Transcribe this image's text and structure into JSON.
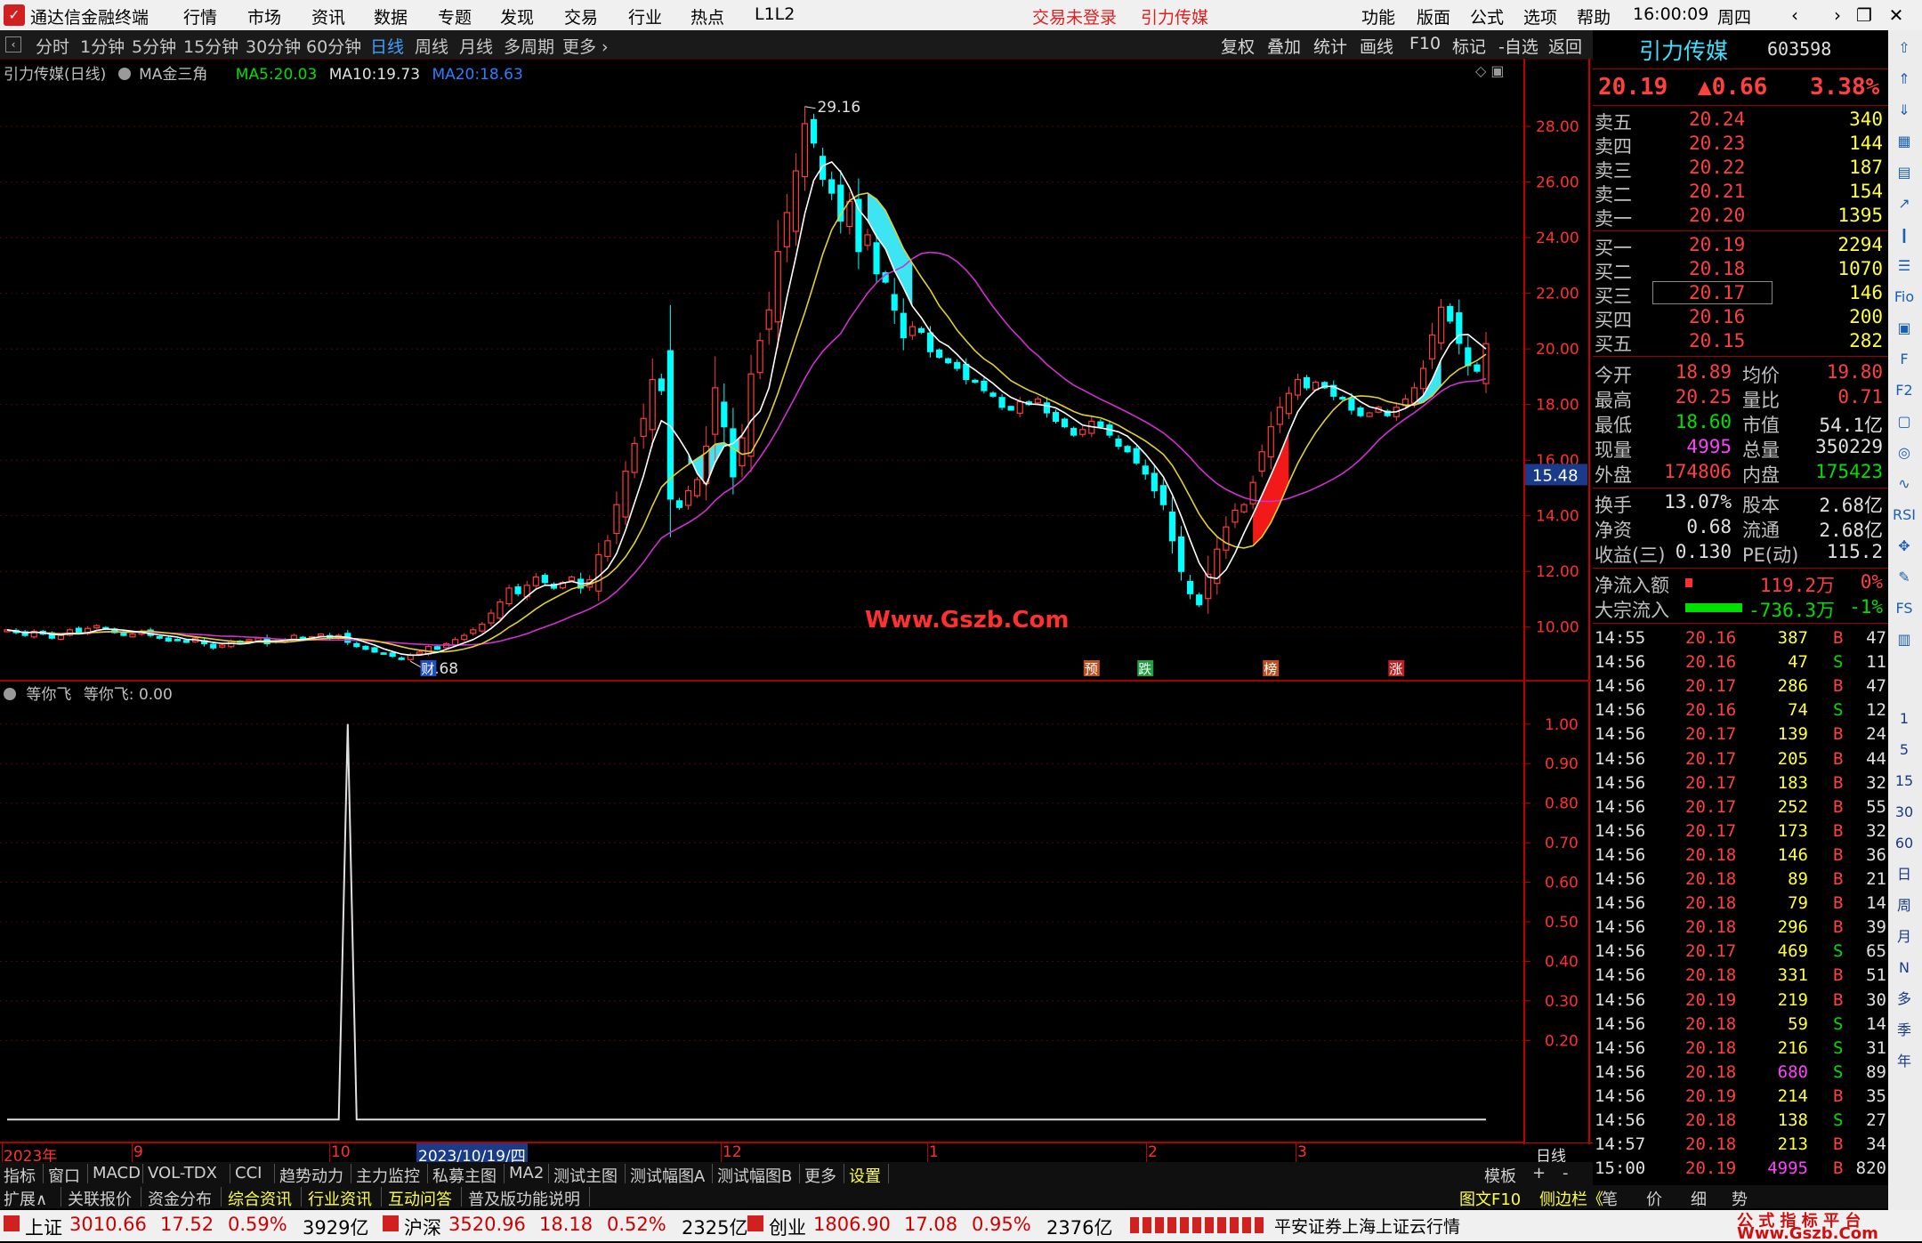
{
  "app": {
    "name": "通达信金融终端",
    "menus": [
      "行情",
      "市场",
      "资讯",
      "数据",
      "专题",
      "发现",
      "交易",
      "行业",
      "热点",
      "L1L2"
    ],
    "login_status": "交易未登录",
    "stock_title": "引力传媒",
    "right_menus": [
      "功能",
      "版面",
      "公式",
      "选项",
      "帮助"
    ],
    "clock": "16:00:09",
    "weekday": "周四",
    "win_buttons": [
      "back-icon",
      "forward-icon",
      "restore-icon",
      "close-icon"
    ],
    "win_glyphs": [
      "‹",
      "›",
      "❐",
      "✕"
    ]
  },
  "periods": {
    "items": [
      "分时",
      "1分钟",
      "5分钟",
      "15分钟",
      "30分钟",
      "60分钟",
      "日线",
      "周线",
      "月线",
      "多周期",
      "更多 ›"
    ],
    "active_index": 6
  },
  "toolbar": [
    "复权",
    "叠加",
    "统计",
    "画线",
    "F10",
    "标记",
    "-自选",
    "返回"
  ],
  "chart_header": {
    "name": "引力传媒(日线)",
    "indicator": "MA金三角",
    "ma5_label": "MA5:",
    "ma5": "20.03",
    "ma10_label": "MA10:",
    "ma10": "19.73",
    "ma20_label": "MA20:",
    "ma20": "18.63"
  },
  "sub_header": {
    "indicator": "等你飞",
    "value_label": "等你飞: 0.00"
  },
  "watermark": "Www.Gszb.Com",
  "event_markers": [
    "财",
    "预",
    "跌",
    "榜",
    "涨"
  ],
  "current_price_label": "15.48",
  "chart_data": [
    {
      "type": "candlestick",
      "title": "引力传媒(日线)",
      "y_ticks": [
        10.0,
        12.0,
        14.0,
        16.0,
        18.0,
        20.0,
        22.0,
        24.0,
        26.0,
        28.0
      ],
      "ylim": [
        8.2,
        29.6
      ],
      "high_label": "29.16",
      "low_label": "8.68",
      "series": [
        {
          "name": "MA5",
          "color": "#ffffff"
        },
        {
          "name": "MA10",
          "color": "#e0d030"
        },
        {
          "name": "MA20",
          "color": "#d030d0"
        }
      ],
      "close": [
        9.9,
        9.8,
        9.7,
        9.85,
        9.75,
        9.6,
        9.7,
        9.9,
        9.8,
        9.95,
        10.05,
        9.95,
        9.8,
        9.7,
        9.75,
        9.85,
        9.7,
        9.6,
        9.5,
        9.55,
        9.45,
        9.6,
        9.4,
        9.25,
        9.35,
        9.5,
        9.45,
        9.55,
        9.6,
        9.4,
        9.5,
        9.55,
        9.7,
        9.6,
        9.65,
        9.75,
        9.6,
        9.7,
        9.45,
        9.3,
        9.2,
        9.1,
        9.05,
        8.95,
        8.85,
        9.0,
        9.1,
        9.3,
        9.2,
        9.4,
        9.55,
        9.7,
        9.9,
        10.1,
        10.5,
        10.9,
        11.4,
        11.2,
        11.5,
        11.8,
        11.6,
        11.4,
        11.6,
        11.8,
        11.4,
        11.7,
        12.6,
        13.1,
        14.4,
        15.6,
        16.6,
        17.5,
        18.9,
        18.5,
        14.6,
        14.3,
        14.9,
        15.3,
        16.5,
        18.6,
        17.2,
        15.4,
        16.8,
        19.1,
        20.3,
        21.4,
        23.5,
        24.9,
        26.4,
        28.1,
        27.4,
        26.1,
        25.6,
        24.6,
        25.3,
        23.5,
        24.1,
        22.7,
        22.4,
        21.4,
        20.4,
        20.8,
        20.6,
        19.9,
        19.7,
        19.5,
        19.3,
        18.9,
        18.8,
        18.5,
        18.3,
        17.9,
        17.8,
        18.1,
        18.0,
        18.2,
        17.7,
        17.4,
        17.2,
        16.9,
        17.1,
        17.4,
        17.2,
        16.9,
        16.5,
        16.3,
        15.9,
        15.5,
        14.9,
        14.4,
        13.1,
        12.0,
        11.2,
        10.8,
        11.9,
        12.8,
        13.6,
        14.2,
        14.4,
        15.2,
        16.3,
        17.2,
        17.9,
        18.4,
        18.9,
        18.6,
        18.8,
        18.6,
        18.3,
        18.2,
        17.8,
        17.6,
        17.7,
        17.9,
        17.6,
        17.9,
        18.2,
        18.6,
        19.3,
        20.5,
        21.5,
        21.0,
        20.2,
        19.4,
        19.2,
        20.19
      ],
      "sub_type": "line",
      "sub_y_ticks": [
        0.2,
        0.3,
        0.4,
        0.5,
        0.6,
        0.7,
        0.8,
        0.9,
        1.0
      ],
      "sub_ylim": [
        -0.04,
        1.04
      ],
      "sub_signal_bar": 38,
      "time_labels": [
        "2023年",
        "9",
        "10",
        "2023/10/19/四",
        "12",
        "1",
        "2",
        "3"
      ]
    }
  ],
  "quote": {
    "name": "引力传媒",
    "code": "603598",
    "price": "20.19",
    "change": "▲0.66",
    "pct": "3.38%",
    "asks": [
      {
        "label": "卖五",
        "price": "20.24",
        "vol": "340"
      },
      {
        "label": "卖四",
        "price": "20.23",
        "vol": "144"
      },
      {
        "label": "卖三",
        "price": "20.22",
        "vol": "187"
      },
      {
        "label": "卖二",
        "price": "20.21",
        "vol": "154"
      },
      {
        "label": "卖一",
        "price": "20.20",
        "vol": "1395"
      }
    ],
    "bids": [
      {
        "label": "买一",
        "price": "20.19",
        "vol": "2294"
      },
      {
        "label": "买二",
        "price": "20.18",
        "vol": "1070"
      },
      {
        "label": "买三",
        "price": "20.17",
        "vol": "146"
      },
      {
        "label": "买四",
        "price": "20.16",
        "vol": "200"
      },
      {
        "label": "买五",
        "price": "20.15",
        "vol": "282"
      }
    ],
    "stats": [
      [
        "今开",
        "18.89",
        "red",
        "均价",
        "19.80",
        "red"
      ],
      [
        "最高",
        "20.25",
        "red",
        "量比",
        "0.71",
        "red"
      ],
      [
        "最低",
        "18.60",
        "green",
        "市值",
        "54.1亿",
        "white"
      ],
      [
        "现量",
        "4995",
        "magenta",
        "总量",
        "350229",
        "white"
      ],
      [
        "外盘",
        "174806",
        "red",
        "内盘",
        "175423",
        "green"
      ]
    ],
    "stats2": [
      [
        "换手",
        "13.07%",
        "white",
        "股本",
        "2.68亿",
        "white"
      ],
      [
        "净资",
        "0.68",
        "white",
        "流通",
        "2.68亿",
        "white"
      ],
      [
        "收益(三)",
        "0.130",
        "white",
        "PE(动)",
        "115.2",
        "white"
      ]
    ],
    "flow": [
      {
        "label": "净流入额",
        "value": "119.2万",
        "pct": "0%",
        "color": "red"
      },
      {
        "label": "大宗流入",
        "value": "-736.3万",
        "pct": "-1%",
        "color": "green"
      }
    ],
    "ticks": [
      [
        "14:55",
        "20.16",
        "387",
        "B",
        "47"
      ],
      [
        "14:56",
        "20.16",
        "47",
        "S",
        "11"
      ],
      [
        "14:56",
        "20.17",
        "286",
        "B",
        "47"
      ],
      [
        "14:56",
        "20.16",
        "74",
        "S",
        "12"
      ],
      [
        "14:56",
        "20.17",
        "139",
        "B",
        "24"
      ],
      [
        "14:56",
        "20.17",
        "205",
        "B",
        "44"
      ],
      [
        "14:56",
        "20.17",
        "183",
        "B",
        "32"
      ],
      [
        "14:56",
        "20.17",
        "252",
        "B",
        "55"
      ],
      [
        "14:56",
        "20.17",
        "173",
        "B",
        "32"
      ],
      [
        "14:56",
        "20.18",
        "146",
        "B",
        "36"
      ],
      [
        "14:56",
        "20.18",
        "89",
        "B",
        "21"
      ],
      [
        "14:56",
        "20.18",
        "79",
        "B",
        "14"
      ],
      [
        "14:56",
        "20.18",
        "296",
        "B",
        "39"
      ],
      [
        "14:56",
        "20.17",
        "469",
        "S",
        "65"
      ],
      [
        "14:56",
        "20.18",
        "331",
        "B",
        "51"
      ],
      [
        "14:56",
        "20.19",
        "219",
        "B",
        "30"
      ],
      [
        "14:56",
        "20.18",
        "59",
        "S",
        "14"
      ],
      [
        "14:56",
        "20.18",
        "216",
        "S",
        "31"
      ],
      [
        "14:56",
        "20.18",
        "680",
        "S",
        "89"
      ],
      [
        "14:56",
        "20.19",
        "214",
        "B",
        "35"
      ],
      [
        "14:56",
        "20.18",
        "138",
        "S",
        "27"
      ],
      [
        "14:57",
        "20.18",
        "213",
        "B",
        "34"
      ],
      [
        "15:00",
        "20.19",
        "4995",
        "B",
        "820"
      ]
    ]
  },
  "side_icons": [
    {
      "name": "up-arrow-icon",
      "glyph": "⇧"
    },
    {
      "name": "up-icon",
      "glyph": "⇑"
    },
    {
      "name": "down-icon",
      "glyph": "⇓"
    },
    {
      "name": "chart-icon",
      "glyph": "▦"
    },
    {
      "name": "table-icon",
      "glyph": "▤"
    },
    {
      "name": "line-chart-icon",
      "glyph": "↗"
    },
    {
      "name": "candle-icon",
      "glyph": "❙"
    },
    {
      "name": "list-icon",
      "glyph": "☰"
    },
    {
      "name": "f10-icon",
      "glyph": "Fio"
    },
    {
      "name": "news-icon",
      "glyph": "▣"
    },
    {
      "name": "doc-icon",
      "glyph": "F"
    },
    {
      "name": "f2-icon",
      "glyph": "F2"
    },
    {
      "name": "lock-icon",
      "glyph": "▢"
    },
    {
      "name": "clock-icon",
      "glyph": "◎"
    },
    {
      "name": "wave-icon",
      "glyph": "∿"
    },
    {
      "name": "rsi-icon",
      "glyph": "RSI"
    },
    {
      "name": "move-icon",
      "glyph": "✥"
    },
    {
      "name": "pen-icon",
      "glyph": "✎"
    },
    {
      "name": "fs-icon",
      "glyph": "FS"
    },
    {
      "name": "bars-icon",
      "glyph": "▥"
    }
  ],
  "side_periods": [
    "1",
    "5",
    "15",
    "30",
    "60",
    "日",
    "周",
    "月",
    "N",
    "多",
    "季",
    "年"
  ],
  "tabs": [
    "指标",
    "窗口",
    "MACD",
    "VOL-TDX",
    "CCI",
    "趋势动力",
    "主力监控",
    "私募主图",
    "MA2",
    "测试主图",
    "测试幅图A",
    "测试幅图B",
    "更多",
    "设置"
  ],
  "tabs_right": [
    "模板",
    "+",
    "-"
  ],
  "tabs2": [
    "扩展∧",
    "关联报价",
    "资金分布",
    "综合资讯",
    "行业资讯",
    "互动问答",
    "普及版功能说明"
  ],
  "tabs2_right": [
    "图文F10",
    "侧边栏《",
    "笔",
    "价",
    "细",
    "势"
  ],
  "right_tabs": [
    "日线"
  ],
  "status": {
    "indices": [
      {
        "name": "上证",
        "value": "3010.66",
        "chg": "17.52",
        "pct": "0.59%",
        "amt": "3929亿"
      },
      {
        "name": "沪深",
        "value": "3520.96",
        "chg": "18.18",
        "pct": "0.52%",
        "amt": "2325亿"
      },
      {
        "name": "创业",
        "value": "1806.90",
        "chg": "17.08",
        "pct": "0.95%",
        "amt": "2376亿"
      }
    ],
    "broker": "平安证券上海上证云行情",
    "brand_top": "公 式 指 标 平 台",
    "brand_bottom": "Www.Gszb.Com"
  },
  "colors": {
    "up": "#ff3b3b",
    "down": "#00ffff",
    "bg": "#000000",
    "grid": "#3a0000",
    "axis": "#ff3b3b"
  }
}
